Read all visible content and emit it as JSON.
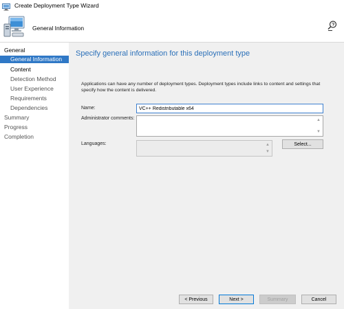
{
  "window": {
    "title": "Create Deployment Type Wizard"
  },
  "header": {
    "title": "General Information"
  },
  "nav": {
    "general": "General",
    "general_information": "General Information",
    "content": "Content",
    "detection_method": "Detection Method",
    "user_experience": "User Experience",
    "requirements": "Requirements",
    "dependencies": "Dependencies",
    "summary": "Summary",
    "progress": "Progress",
    "completion": "Completion"
  },
  "main": {
    "heading": "Specify general information for this deployment type",
    "description": "Applications can have any number of deployment types. Deployment types include links to content and settings that specify how the content is delivered.",
    "name_label": "Name:",
    "name_value": "VC++ Redistributable x64",
    "admin_comments_label": "Administrator comments:",
    "admin_comments_value": "",
    "languages_label": "Languages:",
    "select_button": "Select..."
  },
  "buttons": {
    "previous": "< Previous",
    "next": "Next >",
    "summary": "Summary",
    "cancel": "Cancel"
  },
  "colors": {
    "selection": "#2f78c6",
    "heading": "#2a6fb8",
    "pane_background": "#f0f0f0"
  },
  "icons": {
    "title": "wizard-icon",
    "banner": "computer-icon",
    "help": "help-icon"
  }
}
